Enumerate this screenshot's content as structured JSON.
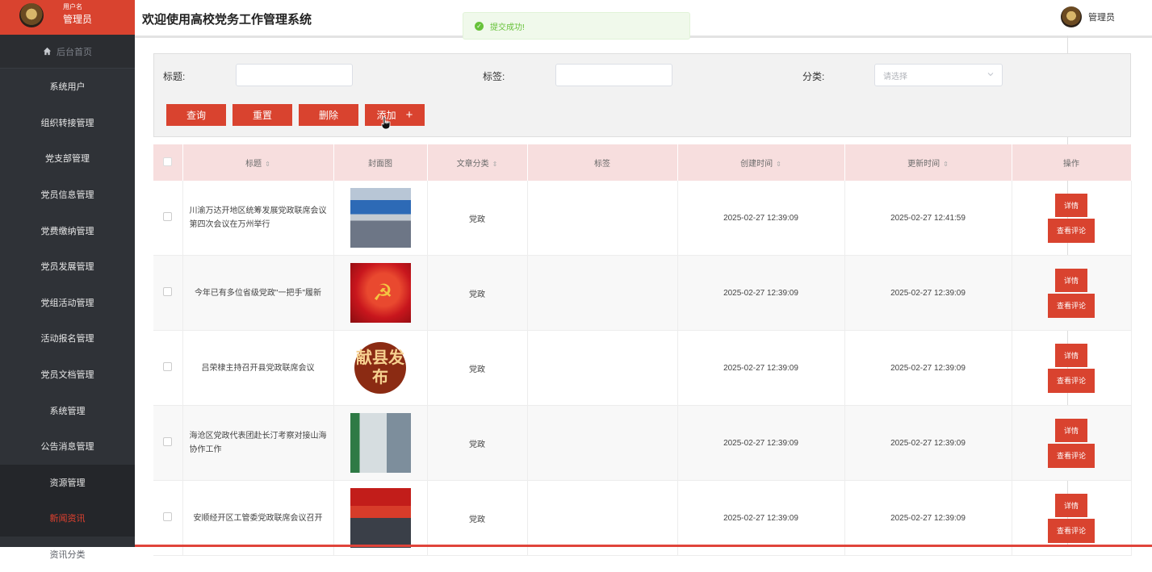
{
  "sidebar": {
    "user_label": "用户名",
    "user_role": "管理员",
    "home": "后台首页",
    "items": [
      {
        "label": "系统用户",
        "state": "normal"
      },
      {
        "label": "组织转接管理",
        "state": "normal"
      },
      {
        "label": "党支部管理",
        "state": "normal"
      },
      {
        "label": "党员信息管理",
        "state": "normal"
      },
      {
        "label": "党费缴纳管理",
        "state": "normal"
      },
      {
        "label": "党员发展管理",
        "state": "normal"
      },
      {
        "label": "党组活动管理",
        "state": "normal"
      },
      {
        "label": "活动报名管理",
        "state": "normal"
      },
      {
        "label": "党员文档管理",
        "state": "normal"
      },
      {
        "label": "系统管理",
        "state": "normal"
      },
      {
        "label": "公告消息管理",
        "state": "normal"
      },
      {
        "label": "资源管理",
        "state": "group"
      },
      {
        "label": "新闻资讯",
        "state": "active"
      },
      {
        "label": "资讯分类",
        "state": "faded"
      }
    ]
  },
  "header": {
    "title": "欢迎使用高校党务工作管理系统",
    "toast": "提交成功!",
    "user_role": "管理员"
  },
  "search": {
    "title_label": "标题:",
    "tag_label": "标签:",
    "category_label": "分类:",
    "category_placeholder": "请选择",
    "title_value": "",
    "tag_value": ""
  },
  "buttons": {
    "query": "查询",
    "reset": "重置",
    "delete": "删除",
    "add": "添加"
  },
  "table": {
    "headers": {
      "title": "标题",
      "cover": "封面图",
      "category": "文章分类",
      "tag": "标签",
      "created": "创建时间",
      "updated": "更新时间",
      "ops": "操作"
    },
    "op_detail": "详情",
    "op_comment": "查看评论",
    "rows": [
      {
        "title": "川渝万达开地区统筹发展党政联席会议第四次会议在万州举行",
        "category": "党政",
        "tag": "",
        "created": "2025-02-27 12:39:09",
        "updated": "2025-02-27 12:41:59"
      },
      {
        "title": "今年已有多位省级党政\"一把手\"履新",
        "category": "党政",
        "tag": "",
        "created": "2025-02-27 12:39:09",
        "updated": "2025-02-27 12:39:09"
      },
      {
        "title": "吕荣棣主持召开县党政联席会议",
        "category": "党政",
        "tag": "",
        "created": "2025-02-27 12:39:09",
        "updated": "2025-02-27 12:39:09",
        "cover_text": "献县发布"
      },
      {
        "title": "海沧区党政代表团赴长汀考察对接山海协作工作",
        "category": "党政",
        "tag": "",
        "created": "2025-02-27 12:39:09",
        "updated": "2025-02-27 12:39:09"
      },
      {
        "title": "安顺经开区工管委党政联席会议召开",
        "category": "党政",
        "tag": "",
        "created": "2025-02-27 12:39:09",
        "updated": "2025-02-27 12:39:09"
      }
    ]
  },
  "colors": {
    "accent": "#d9432f",
    "sidebar_bg": "#2f3237",
    "header_row_bg": "#f7dede",
    "toast_green": "#67c23a"
  }
}
